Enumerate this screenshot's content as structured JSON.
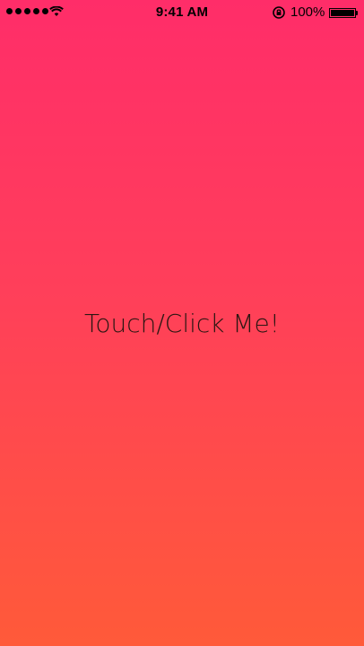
{
  "status_bar": {
    "time": "9:41 AM",
    "battery_percent": "100%",
    "signal_bars": 5,
    "icons": [
      "signal-dots",
      "wifi-icon",
      "orientation-lock-icon",
      "battery-icon"
    ]
  },
  "main": {
    "button_label": "Touch/Click Me!"
  },
  "colors": {
    "gradient_top": "#ff2d69",
    "gradient_bottom": "#ff5a39",
    "text": "#2a1712"
  }
}
